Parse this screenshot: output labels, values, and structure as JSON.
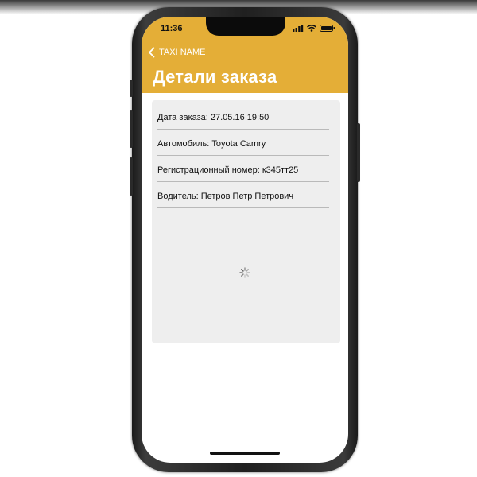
{
  "status_bar": {
    "time": "11:36"
  },
  "nav": {
    "back_label": "TAXI NAME",
    "title": "Детали заказа"
  },
  "details": {
    "rows": [
      {
        "label": "Дата заказа: 27.05.16 19:50"
      },
      {
        "label": "Автомобиль: Toyota Camry"
      },
      {
        "label": "Регистрационный номер: к345тт25"
      },
      {
        "label": "Водитель: Петров Петр Петрович"
      }
    ]
  },
  "colors": {
    "header": "#E4AE37",
    "card": "#EEEEEE",
    "divider": "#B9B9B9"
  },
  "icons": {
    "back": "chevron-left-icon",
    "signal": "cellular-signal-icon",
    "wifi": "wifi-icon",
    "battery": "battery-icon",
    "loading": "activity-spinner-icon"
  }
}
